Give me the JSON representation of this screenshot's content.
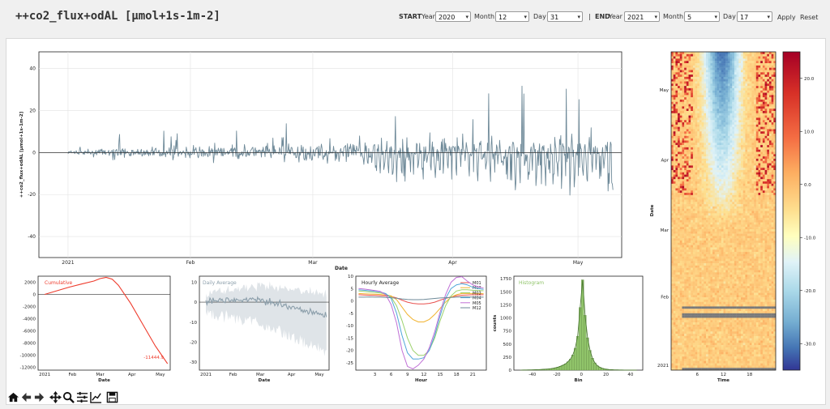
{
  "title": "++co2_flux+odAL [µmol+1s-1m-2]",
  "filters": {
    "start_label": "START",
    "end_label": "END",
    "year_label": "Year",
    "month_label": "Month",
    "day_label": "Day",
    "separator": "|",
    "start_year": "2020",
    "start_month": "12",
    "start_day": "31",
    "end_year": "2021",
    "end_month": "5",
    "end_day": "17",
    "apply_label": "Apply",
    "reset_label": "Reset"
  },
  "colors": {
    "series": "#6f8a99",
    "cumulative": "#ee3b2c",
    "hist": "#90c46a",
    "daily": "#8c9fab"
  },
  "toolbar": [
    "home-icon",
    "back-icon",
    "forward-icon",
    "pan-icon",
    "zoom-icon",
    "configure-icon",
    "edit-curves-icon",
    "save-icon"
  ],
  "chart_data": [
    {
      "type": "line",
      "name": "main",
      "xlabel": "Date",
      "ylabel": "++co2_flux+odAL [µmol+1s-1m-2]",
      "x_ticks": [
        "2021",
        "Feb",
        "Mar",
        "Apr",
        "May"
      ],
      "y_ticks": [
        40,
        20,
        0,
        -20,
        -40
      ],
      "ylim": [
        -50,
        48
      ],
      "xlim": [
        "2020-12-31",
        "2021-05-17"
      ],
      "grid": true
    },
    {
      "type": "line",
      "name": "cumulative",
      "label": "Cumulative",
      "annotation": "-11444.9",
      "xlabel": "Date",
      "x_ticks": [
        "2021",
        "Feb",
        "Mar",
        "Apr",
        "May"
      ],
      "y_ticks": [
        2000,
        0,
        -2000,
        -4000,
        -6000,
        -8000,
        -10000,
        -12000
      ],
      "ylim": [
        -12500,
        3000
      ],
      "points": [
        [
          0,
          0
        ],
        [
          0.1,
          600
        ],
        [
          0.2,
          1200
        ],
        [
          0.3,
          1700
        ],
        [
          0.4,
          2200
        ],
        [
          0.45,
          2600
        ],
        [
          0.5,
          2800
        ],
        [
          0.55,
          2500
        ],
        [
          0.6,
          1500
        ],
        [
          0.7,
          -1500
        ],
        [
          0.8,
          -5000
        ],
        [
          0.9,
          -8500
        ],
        [
          1.0,
          -11444.9
        ]
      ]
    },
    {
      "type": "line",
      "name": "daily-average",
      "label": "Daily Average",
      "xlabel": "Date",
      "x_ticks": [
        "2021",
        "Feb",
        "Mar",
        "Apr",
        "May"
      ],
      "y_ticks": [
        10,
        0,
        -10,
        -20,
        -30
      ],
      "ylim": [
        -34,
        13
      ]
    },
    {
      "type": "line",
      "name": "hourly-average",
      "label": "Hourly Average",
      "xlabel": "Hour",
      "x_ticks": [
        3,
        6,
        9,
        12,
        15,
        18,
        21
      ],
      "y_ticks": [
        10,
        5,
        0,
        -5,
        -10,
        -15,
        -20,
        -25
      ],
      "ylim": [
        -28,
        10
      ],
      "x": [
        0,
        1,
        2,
        3,
        4,
        5,
        6,
        7,
        8,
        9,
        10,
        11,
        12,
        13,
        14,
        15,
        16,
        17,
        18,
        19,
        20,
        21,
        22,
        23
      ],
      "series": [
        {
          "name": "M01",
          "color": "#e8504e",
          "values": [
            2.5,
            2.4,
            2.3,
            2.2,
            2.1,
            2.0,
            1.8,
            1.2,
            0.3,
            -0.5,
            -1.0,
            -1.2,
            -1.2,
            -1.0,
            -0.5,
            0.3,
            1.0,
            1.6,
            2.0,
            2.3,
            2.4,
            2.5,
            2.5,
            2.5
          ]
        },
        {
          "name": "M02",
          "color": "#f1b32f",
          "values": [
            3.0,
            2.9,
            2.8,
            2.7,
            2.6,
            2.4,
            2.0,
            0.5,
            -2.5,
            -5.5,
            -7.5,
            -8.5,
            -8.5,
            -7.5,
            -5.5,
            -3.0,
            -0.5,
            1.5,
            2.5,
            3.0,
            3.0,
            3.0,
            3.0,
            3.0
          ]
        },
        {
          "name": "M03",
          "color": "#9bd16b",
          "values": [
            4.0,
            3.8,
            3.6,
            3.4,
            3.2,
            2.8,
            1.5,
            -2.0,
            -8.0,
            -15.0,
            -20.0,
            -22.0,
            -22.0,
            -20.0,
            -15.0,
            -8.0,
            -2.0,
            2.0,
            4.0,
            4.5,
            4.5,
            4.3,
            4.2,
            4.1
          ]
        },
        {
          "name": "M04",
          "color": "#4fa6d9",
          "values": [
            4.5,
            4.3,
            4.1,
            3.9,
            3.6,
            3.0,
            1.0,
            -5.0,
            -14.0,
            -21.0,
            -23.5,
            -23.5,
            -23.0,
            -20.0,
            -14.0,
            -6.0,
            1.0,
            5.0,
            6.5,
            7.0,
            6.5,
            5.5,
            5.0,
            4.7
          ]
        },
        {
          "name": "M05",
          "color": "#c070d6",
          "values": [
            5.0,
            4.8,
            4.5,
            4.2,
            3.8,
            2.5,
            -1.5,
            -9.0,
            -20.0,
            -26.5,
            -27.5,
            -26.0,
            -23.5,
            -19.0,
            -12.5,
            -4.5,
            2.5,
            7.5,
            9.5,
            9.8,
            8.0,
            6.5,
            5.7,
            5.2
          ]
        },
        {
          "name": "M12",
          "color": "#6f8a99",
          "values": [
            1.5,
            1.5,
            1.6,
            1.5,
            1.5,
            1.4,
            1.3,
            1.1,
            0.8,
            0.6,
            0.5,
            0.5,
            0.6,
            0.8,
            1.0,
            1.2,
            1.3,
            1.4,
            1.5,
            1.6,
            1.6,
            1.5,
            1.5,
            1.5
          ]
        }
      ]
    },
    {
      "type": "bar",
      "name": "histogram",
      "label": "Histogram",
      "xlabel": "Bin",
      "ylabel": "counts",
      "x_ticks": [
        -40,
        -20,
        0,
        20,
        40
      ],
      "y_ticks": [
        0,
        250,
        500,
        750,
        1000,
        1250,
        1500,
        1750
      ],
      "ylim": [
        0,
        1800
      ],
      "bins": [
        -50,
        -48,
        -46,
        -44,
        -42,
        -40,
        -38,
        -36,
        -34,
        -32,
        -30,
        -28,
        -26,
        -24,
        -22,
        -20,
        -18,
        -16,
        -14,
        -12,
        -10,
        -8,
        -6,
        -4,
        -2,
        0,
        2,
        4,
        6,
        8,
        10,
        12,
        14,
        16,
        18,
        20,
        22,
        24,
        26,
        28,
        30,
        32,
        34,
        36,
        38,
        40,
        42,
        44
      ],
      "values": [
        2,
        3,
        3,
        4,
        5,
        6,
        8,
        10,
        12,
        15,
        18,
        22,
        28,
        35,
        45,
        58,
        75,
        95,
        120,
        160,
        210,
        290,
        420,
        650,
        1200,
        1730,
        1050,
        620,
        380,
        230,
        140,
        85,
        55,
        35,
        22,
        15,
        10,
        7,
        5,
        4,
        3,
        3,
        2,
        2,
        1,
        1,
        1,
        0
      ]
    },
    {
      "type": "heatmap",
      "name": "diurnal-heatmap",
      "xlabel": "Time",
      "ylabel": "Date",
      "x_ticks": [
        6,
        12,
        18
      ],
      "y_ticks": [
        "May",
        "Apr",
        "Mar",
        "Feb",
        "2021"
      ],
      "colorbar_ticks": [
        20.0,
        10.0,
        0.0,
        -10.0,
        -20.0,
        -30.0
      ],
      "zlim": [
        -35,
        25
      ],
      "colormap": "RdYlBu_r"
    }
  ]
}
